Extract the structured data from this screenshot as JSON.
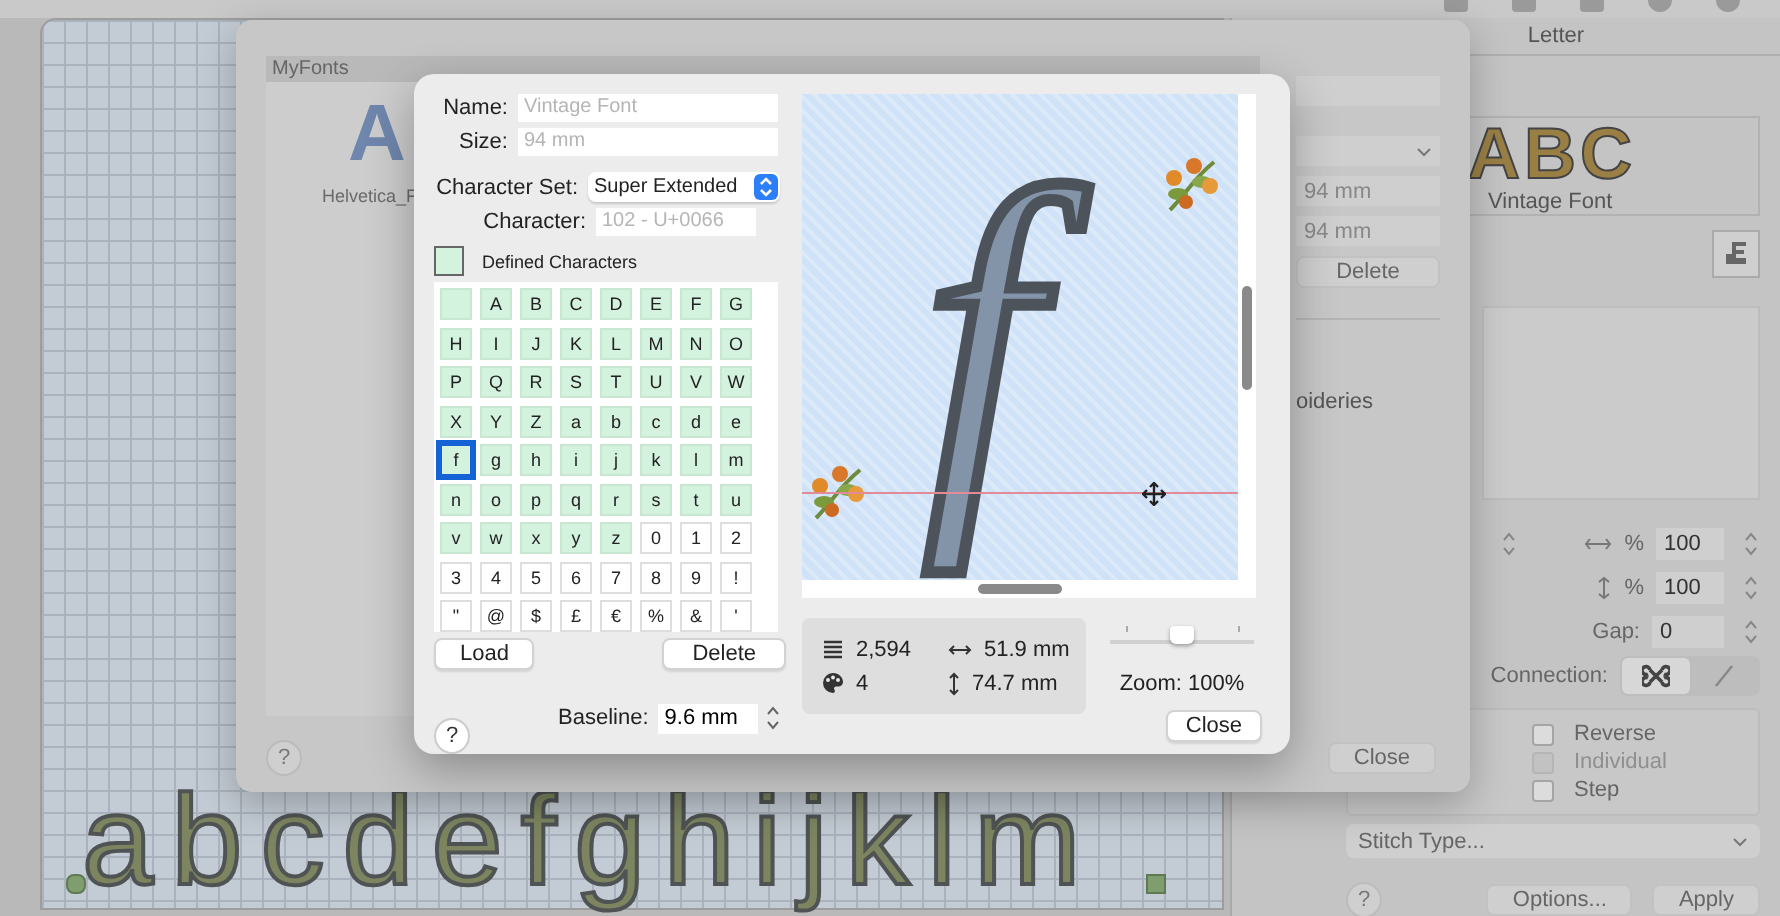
{
  "canvas": {
    "lettering": "abcdefghijklm"
  },
  "side_panel": {
    "title": "Letter",
    "font_preview": {
      "sample": "ABC",
      "name": "Vintage Font"
    },
    "width_scale": {
      "unit": "%",
      "value": "100"
    },
    "height_scale": {
      "unit": "%",
      "value": "100"
    },
    "gap": {
      "label": "Gap:",
      "value": "0"
    },
    "connection": {
      "label": "Connection:",
      "segments": [
        {
          "kind": "jump",
          "selected": true
        },
        {
          "kind": "line",
          "selected": false
        }
      ]
    },
    "options": [
      {
        "label": "Reverse",
        "checked": false,
        "disabled": false
      },
      {
        "label": "Individual",
        "checked": false,
        "disabled": true
      },
      {
        "label": "Step",
        "checked": false,
        "disabled": false
      }
    ],
    "stitch_type": "Stitch Type...",
    "help": "?",
    "buttons": [
      "Options...",
      "Apply"
    ]
  },
  "myfonts_dialog": {
    "list_title": "MyFonts",
    "fonts": [
      {
        "sample": "A",
        "name": "Helvetica_F"
      }
    ],
    "fields": [
      "94 mm",
      "94 mm"
    ],
    "delete": "Delete",
    "partial_label": "oideries",
    "close": "Close",
    "help": "?"
  },
  "editor": {
    "name": {
      "label": "Name:",
      "placeholder": "Vintage Font"
    },
    "size": {
      "label": "Size:",
      "placeholder": "94 mm"
    },
    "character_set": {
      "label": "Character Set:",
      "value": "Super Extended"
    },
    "character": {
      "label": "Character:",
      "placeholder": "102 - U+0066"
    },
    "legend": "Defined Characters",
    "characters": [
      {
        "defined": true,
        "selected": false
      },
      {
        "char": "A",
        "defined": true,
        "selected": false
      },
      {
        "char": "B",
        "defined": true,
        "selected": false
      },
      {
        "char": "C",
        "defined": true,
        "selected": false
      },
      {
        "char": "D",
        "defined": true,
        "selected": false
      },
      {
        "char": "E",
        "defined": true,
        "selected": false
      },
      {
        "char": "F",
        "defined": true,
        "selected": false
      },
      {
        "char": "G",
        "defined": true,
        "selected": false
      },
      {
        "char": "H",
        "defined": true,
        "selected": false
      },
      {
        "char": "I",
        "defined": true,
        "selected": false
      },
      {
        "char": "J",
        "defined": true,
        "selected": false
      },
      {
        "char": "K",
        "defined": true,
        "selected": false
      },
      {
        "char": "L",
        "defined": true,
        "selected": false
      },
      {
        "char": "M",
        "defined": true,
        "selected": false
      },
      {
        "char": "N",
        "defined": true,
        "selected": false
      },
      {
        "char": "O",
        "defined": true,
        "selected": false
      },
      {
        "char": "P",
        "defined": true,
        "selected": false
      },
      {
        "char": "Q",
        "defined": true,
        "selected": false
      },
      {
        "char": "R",
        "defined": true,
        "selected": false
      },
      {
        "char": "S",
        "defined": true,
        "selected": false
      },
      {
        "char": "T",
        "defined": true,
        "selected": false
      },
      {
        "char": "U",
        "defined": true,
        "selected": false
      },
      {
        "char": "V",
        "defined": true,
        "selected": false
      },
      {
        "char": "W",
        "defined": true,
        "selected": false
      },
      {
        "char": "X",
        "defined": true,
        "selected": false
      },
      {
        "char": "Y",
        "defined": true,
        "selected": false
      },
      {
        "char": "Z",
        "defined": true,
        "selected": false
      },
      {
        "char": "a",
        "defined": true,
        "selected": false
      },
      {
        "char": "b",
        "defined": true,
        "selected": false
      },
      {
        "char": "c",
        "defined": true,
        "selected": false
      },
      {
        "char": "d",
        "defined": true,
        "selected": false
      },
      {
        "char": "e",
        "defined": true,
        "selected": false
      },
      {
        "char": "f",
        "defined": true,
        "selected": true
      },
      {
        "char": "g",
        "defined": true,
        "selected": false
      },
      {
        "char": "h",
        "defined": true,
        "selected": false
      },
      {
        "char": "i",
        "defined": true,
        "selected": false
      },
      {
        "char": "j",
        "defined": true,
        "selected": false
      },
      {
        "char": "k",
        "defined": true,
        "selected": false
      },
      {
        "char": "l",
        "defined": true,
        "selected": false
      },
      {
        "char": "m",
        "defined": true,
        "selected": false
      },
      {
        "char": "n",
        "defined": true,
        "selected": false
      },
      {
        "char": "o",
        "defined": true,
        "selected": false
      },
      {
        "char": "p",
        "defined": true,
        "selected": false
      },
      {
        "char": "q",
        "defined": true,
        "selected": false
      },
      {
        "char": "r",
        "defined": true,
        "selected": false
      },
      {
        "char": "s",
        "defined": true,
        "selected": false
      },
      {
        "char": "t",
        "defined": true,
        "selected": false
      },
      {
        "char": "u",
        "defined": true,
        "selected": false
      },
      {
        "char": "v",
        "defined": true,
        "selected": false
      },
      {
        "char": "w",
        "defined": true,
        "selected": false
      },
      {
        "char": "x",
        "defined": true,
        "selected": false
      },
      {
        "char": "y",
        "defined": true,
        "selected": false
      },
      {
        "char": "z",
        "defined": true,
        "selected": false
      },
      {
        "char": "0",
        "defined": false,
        "selected": false
      },
      {
        "char": "1",
        "defined": false,
        "selected": false
      },
      {
        "char": "2",
        "defined": false,
        "selected": false
      },
      {
        "char": "3",
        "defined": false,
        "selected": false
      },
      {
        "char": "4",
        "defined": false,
        "selected": false
      },
      {
        "char": "5",
        "defined": false,
        "selected": false
      },
      {
        "char": "6",
        "defined": false,
        "selected": false
      },
      {
        "char": "7",
        "defined": false,
        "selected": false
      },
      {
        "char": "8",
        "defined": false,
        "selected": false
      },
      {
        "char": "9",
        "defined": false,
        "selected": false
      },
      {
        "char": "!",
        "defined": false,
        "selected": false
      },
      {
        "char": "\"",
        "defined": false,
        "selected": false
      },
      {
        "char": "@",
        "defined": false,
        "selected": false
      },
      {
        "char": "$",
        "defined": false,
        "selected": false
      },
      {
        "char": "£",
        "defined": false,
        "selected": false
      },
      {
        "char": "€",
        "defined": false,
        "selected": false
      },
      {
        "char": "%",
        "defined": false,
        "selected": false
      },
      {
        "char": "&",
        "defined": false,
        "selected": false
      },
      {
        "char": "'",
        "defined": false,
        "selected": false
      }
    ],
    "load": "Load",
    "delete": "Delete",
    "baseline": {
      "label": "Baseline:",
      "value": "9.6 mm"
    },
    "help": "?",
    "preview": {
      "glyph": "f"
    },
    "stats": {
      "stitches": "2,594",
      "colors": "4",
      "width": "51.9 mm",
      "height": "74.7 mm"
    },
    "zoom": {
      "level": 0.5,
      "label": "Zoom: 100%"
    },
    "close": "Close"
  }
}
